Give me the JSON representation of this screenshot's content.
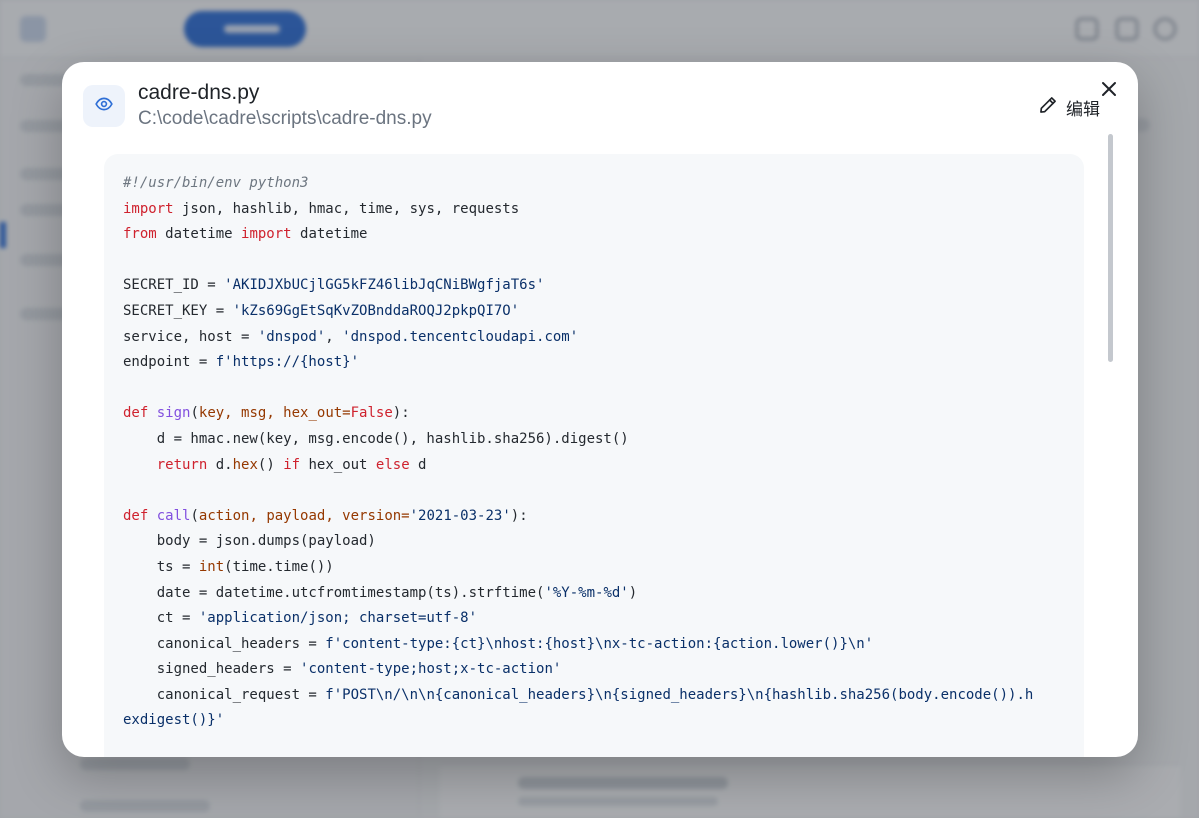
{
  "modal": {
    "file_name": "cadre-dns.py",
    "file_path": "C:\\code\\cadre\\scripts\\cadre-dns.py",
    "edit_label": "编辑",
    "icons": {
      "file": "eye-icon",
      "edit": "pencil-icon",
      "close": "close-icon"
    },
    "accent_color": "#2f6fd6"
  },
  "code": {
    "language": "python",
    "lines": [
      [
        {
          "t": "#!/usr/bin/env python3",
          "c": "com"
        }
      ],
      [
        {
          "t": "import",
          "c": "kw"
        },
        {
          "t": " json, hashlib, hmac, time, sys, requests"
        }
      ],
      [
        {
          "t": "from",
          "c": "kw"
        },
        {
          "t": " datetime "
        },
        {
          "t": "import",
          "c": "kw"
        },
        {
          "t": " datetime"
        }
      ],
      [],
      [
        {
          "t": "SECRET_ID = "
        },
        {
          "t": "'AKIDJXbUCjlGG5kFZ46libJqCNiBWgfjaT6s'",
          "c": "str"
        }
      ],
      [
        {
          "t": "SECRET_KEY = "
        },
        {
          "t": "'kZs69GgEtSqKvZOBnddaROQJ2pkpQI7O'",
          "c": "str"
        }
      ],
      [
        {
          "t": "service, host = "
        },
        {
          "t": "'dnspod'",
          "c": "str"
        },
        {
          "t": ", "
        },
        {
          "t": "'dnspod.tencentcloudapi.com'",
          "c": "str"
        }
      ],
      [
        {
          "t": "endpoint = "
        },
        {
          "t": "f'https://{host}'",
          "c": "str"
        }
      ],
      [],
      [
        {
          "t": "def",
          "c": "kw"
        },
        {
          "t": " "
        },
        {
          "t": "sign",
          "c": "fn"
        },
        {
          "t": "("
        },
        {
          "t": "key, msg, hex_out=",
          "c": "param"
        },
        {
          "t": "False",
          "c": "kw"
        },
        {
          "t": "):"
        }
      ],
      [
        {
          "t": "    d = hmac.new(key, msg.encode(), hashlib.sha256).digest()"
        }
      ],
      [
        {
          "t": "    "
        },
        {
          "t": "return",
          "c": "kw"
        },
        {
          "t": " d."
        },
        {
          "t": "hex",
          "c": "call"
        },
        {
          "t": "() "
        },
        {
          "t": "if",
          "c": "kw"
        },
        {
          "t": " hex_out "
        },
        {
          "t": "else",
          "c": "kw"
        },
        {
          "t": " d"
        }
      ],
      [],
      [
        {
          "t": "def",
          "c": "kw"
        },
        {
          "t": " "
        },
        {
          "t": "call",
          "c": "fn"
        },
        {
          "t": "("
        },
        {
          "t": "action, payload, version=",
          "c": "param"
        },
        {
          "t": "'2021-03-23'",
          "c": "str"
        },
        {
          "t": "):"
        }
      ],
      [
        {
          "t": "    body = json.dumps(payload)"
        }
      ],
      [
        {
          "t": "    ts = "
        },
        {
          "t": "int",
          "c": "call"
        },
        {
          "t": "(time.time())"
        }
      ],
      [
        {
          "t": "    date = datetime.utcfromtimestamp(ts).strftime("
        },
        {
          "t": "'%Y-%m-%d'",
          "c": "str"
        },
        {
          "t": ")"
        }
      ],
      [
        {
          "t": "    ct = "
        },
        {
          "t": "'application/json; charset=utf-8'",
          "c": "str"
        }
      ],
      [
        {
          "t": "    canonical_headers = "
        },
        {
          "t": "f'content-type:{ct}\\nhost:{host}\\nx-tc-action:{action.lower()}\\n'",
          "c": "str"
        }
      ],
      [
        {
          "t": "    signed_headers = "
        },
        {
          "t": "'content-type;host;x-tc-action'",
          "c": "str"
        }
      ],
      [
        {
          "t": "    canonical_request = "
        },
        {
          "t": "f'POST\\n/\\n\\n{canonical_headers}\\n{signed_headers}\\n{hashlib.sha256(body.encode()).h",
          "c": "str"
        }
      ],
      [
        {
          "t": "exdigest()}'",
          "c": "str"
        }
      ]
    ]
  }
}
